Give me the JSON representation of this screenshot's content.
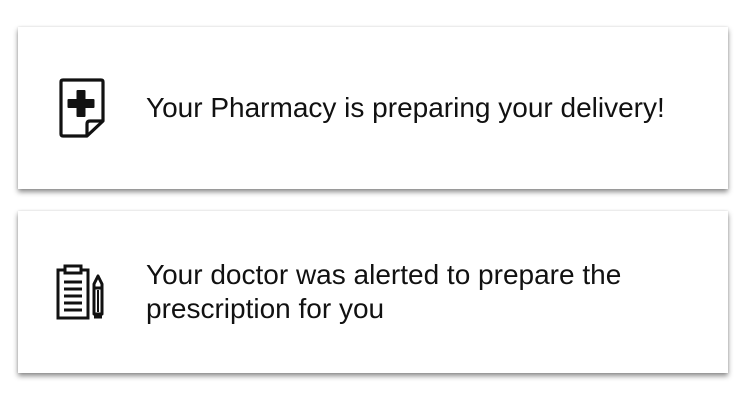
{
  "notifications": [
    {
      "icon": "prescription-document-icon",
      "message": "Your Pharmacy is preparing your delivery!"
    },
    {
      "icon": "clipboard-pencil-icon",
      "message": "Your doctor was alerted to prepare the prescription for you"
    }
  ]
}
